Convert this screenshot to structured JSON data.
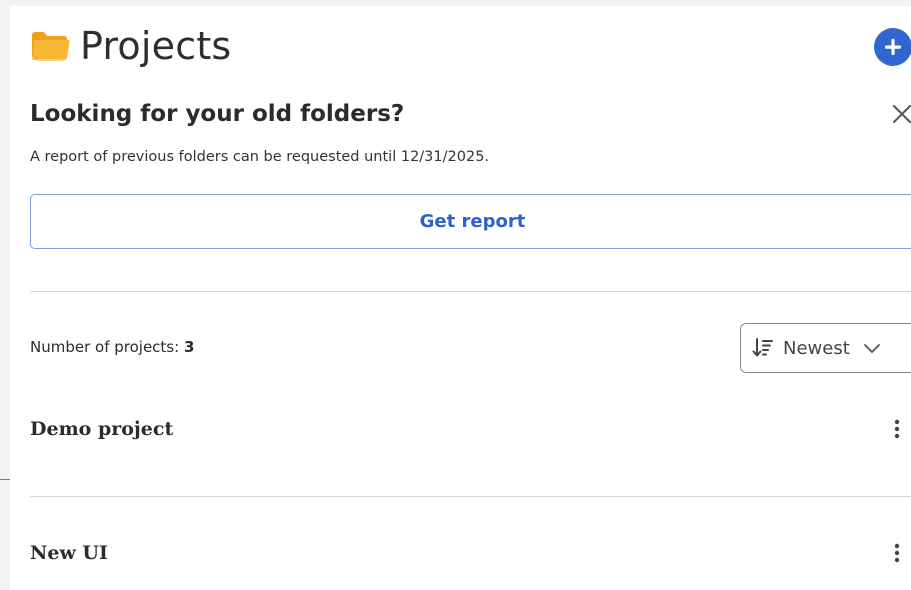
{
  "header": {
    "title": "Projects",
    "folder_icon": "folder-icon",
    "add_icon": "plus-circle-icon",
    "accent": "#2f66cf",
    "folder_color": "#f2a623"
  },
  "notice": {
    "title": "Looking for your old folders?",
    "text": "A report of previous folders can be requested until 12/31/2025.",
    "button_label": "Get report",
    "close_icon": "close-icon"
  },
  "projects_list": {
    "count_label": "Number of projects:",
    "count_value": "3",
    "sort": {
      "selected": "Newest",
      "icon": "sort-descending-icon",
      "chevron": "chevron-down-icon"
    },
    "items": [
      {
        "name": "Demo project",
        "menu_icon": "more-vertical-icon"
      },
      {
        "name": "New UI",
        "menu_icon": "more-vertical-icon"
      }
    ]
  }
}
